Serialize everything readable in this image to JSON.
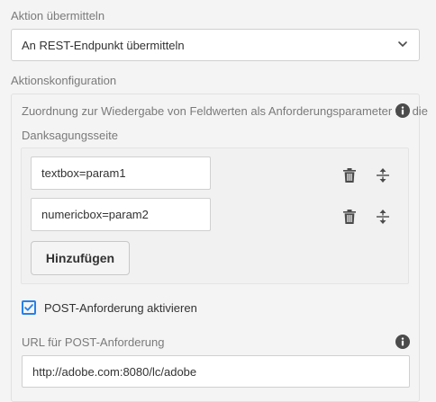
{
  "action": {
    "label": "Aktion übermitteln",
    "selected": "An REST-Endpunkt übermitteln",
    "icon": "chevron-down-icon"
  },
  "config": {
    "label": "Aktionskonfiguration",
    "mapping_label_line1": "Zuordnung zur Wiedergabe von Feldwerten als Anforderungsparameter für die",
    "mapping_label_line2": "Danksagungsseite",
    "rows": [
      {
        "value": "textbox=param1"
      },
      {
        "value": "numericbox=param2"
      }
    ],
    "add_button": "Hinzufügen"
  },
  "post": {
    "checkbox_label": "POST-Anforderung aktivieren",
    "checked": true,
    "url_label": "URL für POST-Anforderung",
    "url_value": "http://adobe.com:8080/lc/adobe"
  },
  "colors": {
    "accent": "#2680eb",
    "text": "#323232",
    "muted": "#7a7a7a"
  }
}
